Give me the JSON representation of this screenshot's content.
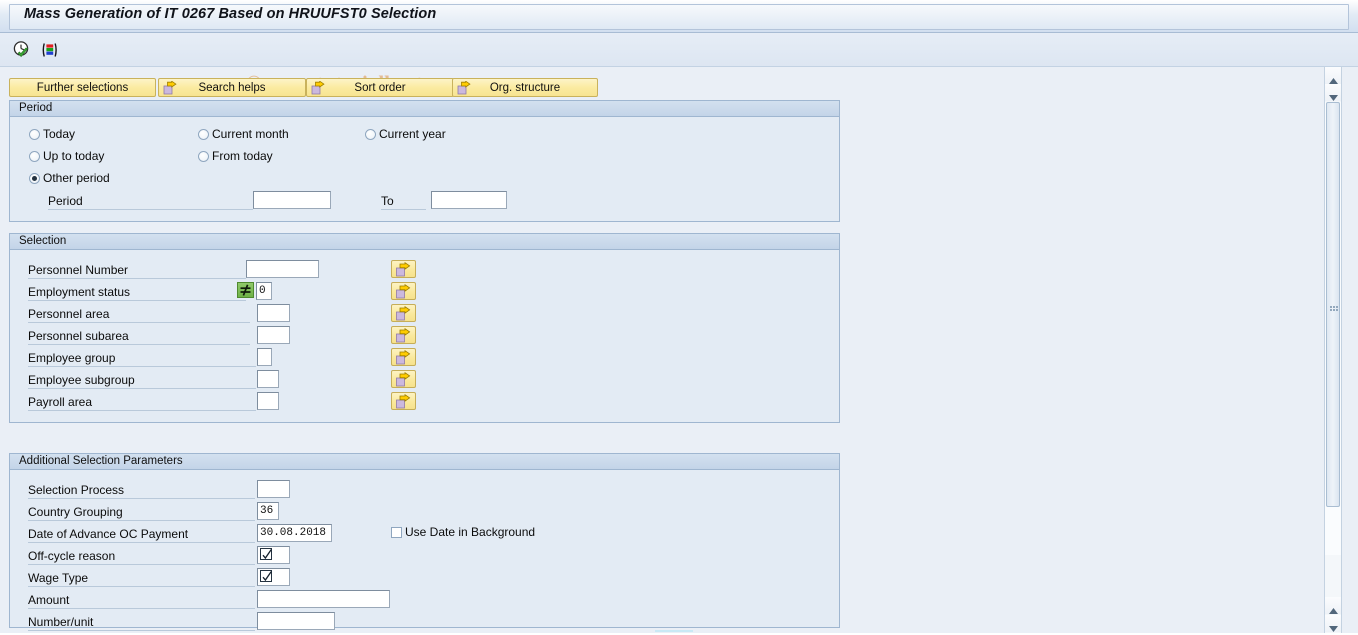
{
  "window": {
    "title": "Mass Generation of IT 0267 Based on HRUUFST0 Selection",
    "watermark": "© www.tutorialkart.com"
  },
  "toolbar": {
    "icons": [
      {
        "name": "execute-check-icon",
        "title": "Execute"
      },
      {
        "name": "variant-icon",
        "title": "Get Variant"
      }
    ]
  },
  "buttons": [
    {
      "label": "Further selections",
      "icon": null
    },
    {
      "label": "Search helps",
      "icon": "arrow-right-icon"
    },
    {
      "label": "Sort order",
      "icon": "arrow-right-icon"
    },
    {
      "label": "Org. structure",
      "icon": "arrow-right-icon"
    }
  ],
  "period": {
    "header": "Period",
    "options": [
      {
        "label": "Today",
        "selected": false
      },
      {
        "label": "Current month",
        "selected": false
      },
      {
        "label": "Current year",
        "selected": false
      },
      {
        "label": "Up to today",
        "selected": false
      },
      {
        "label": "From today",
        "selected": false
      },
      {
        "label": "Other period",
        "selected": true
      }
    ],
    "period_label": "Period",
    "period_value": "",
    "to_label": "To",
    "to_value": ""
  },
  "selection": {
    "header": "Selection",
    "rows": [
      {
        "label": "Personnel Number",
        "value": "",
        "operator": null,
        "has_select": true
      },
      {
        "label": "Employment status",
        "value": "0",
        "operator": "not-equal",
        "has_select": true
      },
      {
        "label": "Personnel area",
        "value": "",
        "operator": null,
        "has_select": true
      },
      {
        "label": "Personnel subarea",
        "value": "",
        "operator": null,
        "has_select": true
      },
      {
        "label": "Employee group",
        "value": "",
        "operator": null,
        "has_select": true
      },
      {
        "label": "Employee subgroup",
        "value": "",
        "operator": null,
        "has_select": true
      },
      {
        "label": "Payroll area",
        "value": "",
        "operator": null,
        "has_select": true
      }
    ]
  },
  "additional": {
    "header": "Additional Selection Parameters",
    "rows": [
      {
        "label": "Selection Process",
        "value": "",
        "kind": "text"
      },
      {
        "label": "Country Grouping",
        "value": "36",
        "kind": "text"
      },
      {
        "label": "Date of Advance OC Payment",
        "value": "30.08.2018",
        "kind": "text"
      },
      {
        "label": "Off-cycle reason",
        "value": "",
        "kind": "multi"
      },
      {
        "label": "Wage Type",
        "value": "",
        "kind": "multi"
      },
      {
        "label": "Amount",
        "value": "",
        "kind": "text"
      },
      {
        "label": "Number/unit",
        "value": "",
        "kind": "text"
      }
    ],
    "use_date_in_background": {
      "label": "Use Date in Background",
      "checked": false
    }
  },
  "colors": {
    "accent_button": "#fbeba1",
    "panel_bg": "#e3ebf4",
    "window_bg": "#eaeff6",
    "operator_green": "#6fb247",
    "watermark": "#e3b383"
  }
}
